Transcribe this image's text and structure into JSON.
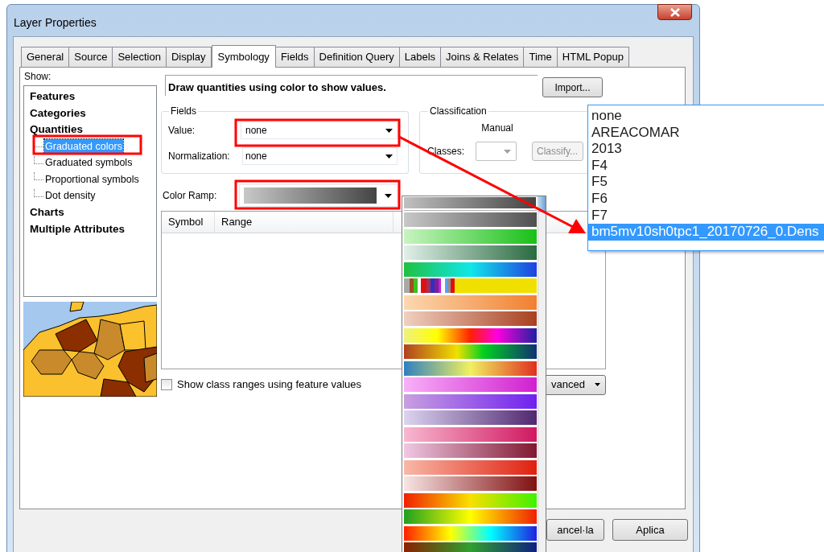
{
  "window": {
    "title": "Layer Properties"
  },
  "tabs": [
    {
      "label": "General",
      "selected": false
    },
    {
      "label": "Source",
      "selected": false
    },
    {
      "label": "Selection",
      "selected": false
    },
    {
      "label": "Display",
      "selected": false
    },
    {
      "label": "Symbology",
      "selected": true
    },
    {
      "label": "Fields",
      "selected": false
    },
    {
      "label": "Definition Query",
      "selected": false
    },
    {
      "label": "Labels",
      "selected": false
    },
    {
      "label": "Joins & Relates",
      "selected": false
    },
    {
      "label": "Time",
      "selected": false
    },
    {
      "label": "HTML Popup",
      "selected": false
    }
  ],
  "show": {
    "label": "Show:",
    "tree": [
      {
        "label": "Features",
        "selected": false
      },
      {
        "label": "Categories",
        "selected": false
      },
      {
        "label": "Quantities",
        "selected": false,
        "children": [
          {
            "label": "Graduated colors",
            "selected": true
          },
          {
            "label": "Graduated symbols",
            "selected": false
          },
          {
            "label": "Proportional symbols",
            "selected": false
          },
          {
            "label": "Dot density",
            "selected": false
          }
        ]
      },
      {
        "label": "Charts",
        "selected": false
      },
      {
        "label": "Multiple Attributes",
        "selected": false
      }
    ]
  },
  "description": "Draw quantities using color to show values.",
  "import_button": "Import...",
  "fields": {
    "title": "Fields",
    "value": {
      "label": "Value:",
      "value": "none"
    },
    "normalization": {
      "label": "Normalization:",
      "value": "none"
    }
  },
  "classification": {
    "title": "Classification",
    "method": "Manual",
    "classes_label": "Classes:",
    "classify_button": "Classify...",
    "disabled": true
  },
  "color_ramp": {
    "label": "Color Ramp:"
  },
  "table": {
    "columns": [
      "Symbol",
      "Range"
    ]
  },
  "show_class_ranges": {
    "label": "Show class ranges using feature values",
    "checked": false
  },
  "advanced_button": "vanced",
  "buttons": [
    "ancel·la",
    "Aplica"
  ],
  "field_dropdown": {
    "items": [
      {
        "label": "none",
        "selected": false
      },
      {
        "label": "AREACOMAR",
        "selected": false
      },
      {
        "label": "2013",
        "selected": false
      },
      {
        "label": "F4",
        "selected": false
      },
      {
        "label": "F5",
        "selected": false
      },
      {
        "label": "F6",
        "selected": false
      },
      {
        "label": "F7",
        "selected": false
      },
      {
        "label": "bm5mv10sh0tpc1_20170726_0.Dens",
        "selected": true
      }
    ]
  }
}
